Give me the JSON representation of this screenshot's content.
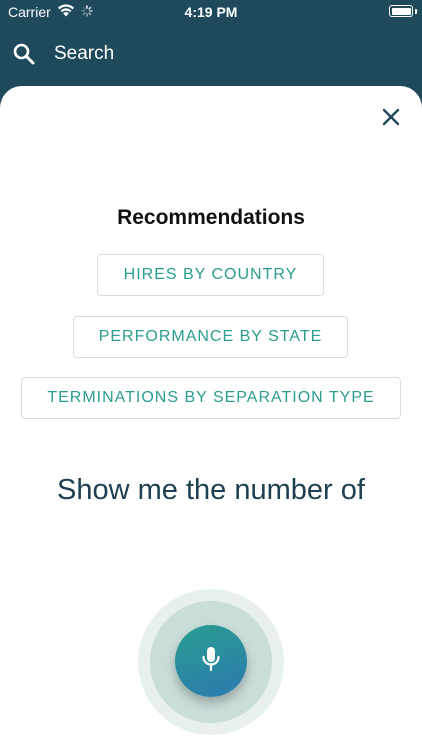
{
  "status_bar": {
    "carrier": "Carrier",
    "time": "4:19 PM",
    "icons": [
      "wifi-icon",
      "activity-spinner-icon",
      "battery-icon"
    ]
  },
  "search": {
    "label": "Search",
    "icon": "search-icon"
  },
  "sheet": {
    "close_icon": "close-icon",
    "recommendations_title": "Recommendations",
    "recommendations": [
      {
        "label": "HIRES BY COUNTRY"
      },
      {
        "label": "PERFORMANCE BY STATE"
      },
      {
        "label": "TERMINATIONS BY SEPARATION TYPE"
      }
    ],
    "prompt_text": "Show me the number of",
    "mic_icon": "microphone-icon"
  },
  "colors": {
    "header_bg": "#1f4a5c",
    "accent_teal": "#2a9d8f",
    "mic_gradient_end": "#2a7ab0",
    "prompt_text": "#1f4050"
  }
}
